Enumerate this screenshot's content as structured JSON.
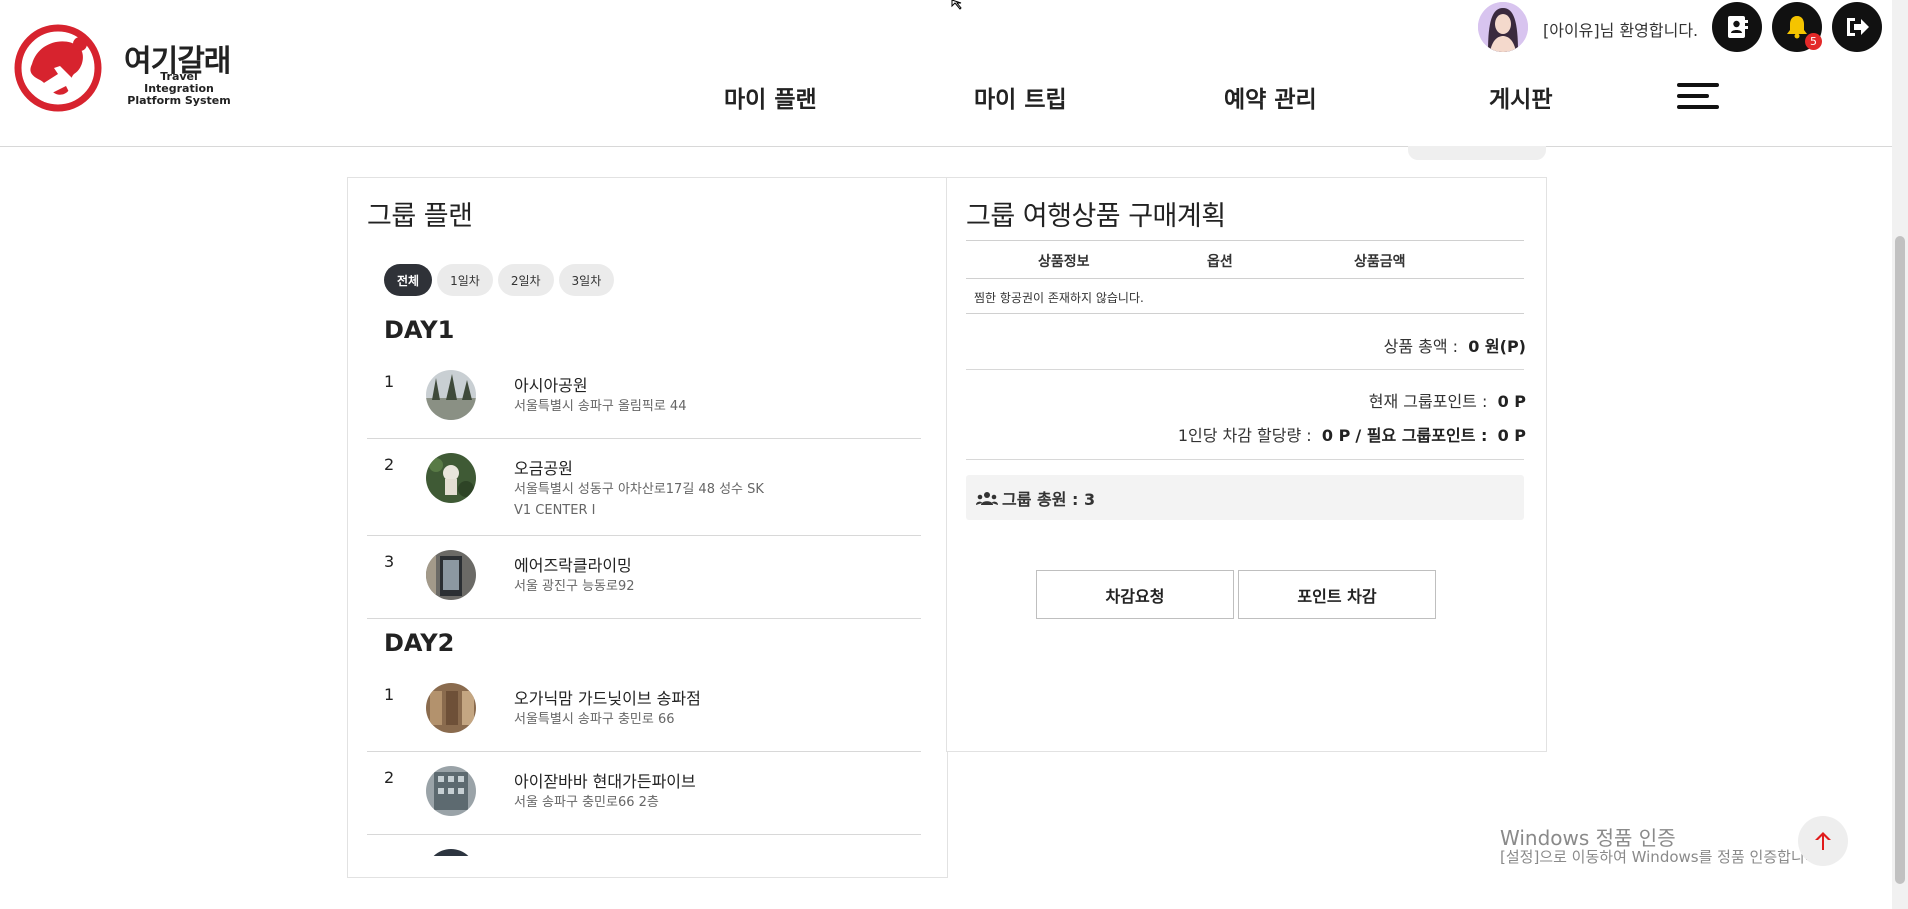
{
  "header": {
    "logo_title": "여기갈래",
    "logo_sub_line1": "Travel Integration",
    "logo_sub_line2": "Platform System",
    "nav": [
      "마이 플랜",
      "마이 트립",
      "예약 관리",
      "게시판"
    ],
    "welcome": "[아이유]님 환영합니다.",
    "notification_count": "5",
    "icons": [
      "contact-book-icon",
      "bell-icon",
      "logout-icon",
      "hamburger-menu-icon"
    ]
  },
  "plan": {
    "title": "그룹 플랜",
    "tabs": [
      "전체",
      "1일차",
      "2일차",
      "3일차"
    ],
    "active_tab": "전체",
    "days": [
      {
        "label": "DAY1",
        "places": [
          {
            "num": "1",
            "name": "아시아공원",
            "addr": "서울특별시 송파구 올림픽로 44"
          },
          {
            "num": "2",
            "name": "오금공원",
            "addr": "서울특별시 성동구 아차산로17길 48 성수 SK V1 CENTER I"
          },
          {
            "num": "3",
            "name": "에어즈락클라이밍",
            "addr": "서울 광진구 능동로92"
          }
        ]
      },
      {
        "label": "DAY2",
        "places": [
          {
            "num": "1",
            "name": "오가닉맘 가드닞이브 송파점",
            "addr": "서울특별시 송파구 충민로 66"
          },
          {
            "num": "2",
            "name": "아이잗바바 현대가든파이브",
            "addr": "서울 송파구 충민로66 2층"
          }
        ]
      }
    ]
  },
  "purchase": {
    "title": "그룹 여행상품 구매계획",
    "columns": [
      "상품정보",
      "옵션",
      "상품금액"
    ],
    "empty_message": "찜한 항공권이 존재하지 않습니다.",
    "total_label": "상품 총액 :",
    "total_value": "0 원(P)",
    "group_point_label": "현재 그룹포인트 :",
    "group_point_value": "0 P",
    "per_person_label": "1인당 차감 할당량 :",
    "per_person_value": "0 P",
    "required_point_label": "/ 필요 그룹포인트 :",
    "required_point_value": "0 P",
    "members_label": "그룹 총원 : 3",
    "btn_request": "차감요청",
    "btn_deduct": "포인트 차감"
  },
  "overlay": {
    "watermark_title": "Windows 정품 인증",
    "watermark_sub": "[설정]으로 이동하여 Windows를 정품 인증합니다."
  },
  "colors": {
    "accent_red": "#d7232e",
    "chip_active": "#2f3238",
    "badge": "#e32929"
  }
}
